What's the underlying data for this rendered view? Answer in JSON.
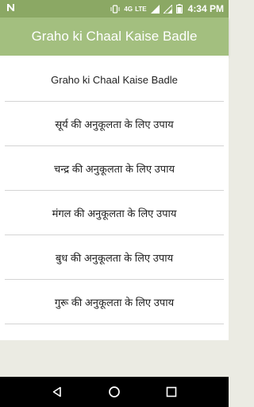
{
  "status_bar": {
    "left_icon": "n-notification-icon",
    "network_label": "LTE",
    "network_sub": "4G",
    "time": "4:34 PM"
  },
  "app_bar": {
    "title": "Graho ki Chaal Kaise Badle"
  },
  "list": {
    "items": [
      {
        "label": "Graho ki Chaal Kaise Badle"
      },
      {
        "label": "सूर्य की अनुकूलता के लिए उपाय"
      },
      {
        "label": "चन्द्र की अनुकूलता के लिए उपाय"
      },
      {
        "label": "मंगल की अनुकूलता के लिए उपाय"
      },
      {
        "label": "बुध की अनुकूलता के लिए उपाय"
      },
      {
        "label": "गुरू की अनुकूलता के लिए उपाय"
      },
      {
        "label": ""
      }
    ]
  },
  "nav_bar": {
    "back": "back-icon",
    "home": "home-icon",
    "recents": "recents-icon"
  },
  "colors": {
    "status_bar": "#8ba864",
    "app_bar": "#a3bf7f",
    "background": "#ebebe3"
  }
}
